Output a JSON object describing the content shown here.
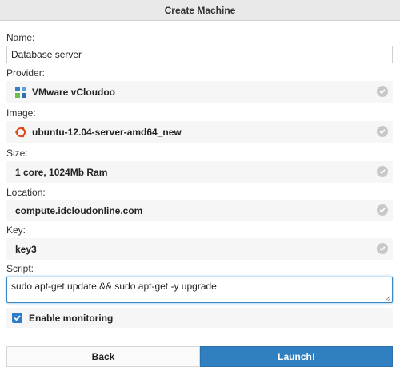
{
  "header": {
    "title": "Create Machine"
  },
  "fields": {
    "name": {
      "label": "Name:",
      "value": "Database server"
    },
    "provider": {
      "label": "Provider:",
      "value": "VMware vCloudoo",
      "icon": "vmware-icon"
    },
    "image": {
      "label": "Image:",
      "value": "ubuntu-12.04-server-amd64_new",
      "icon": "ubuntu-icon"
    },
    "size": {
      "label": "Size:",
      "value": "1 core, 1024Mb Ram"
    },
    "location": {
      "label": "Location:",
      "value": "compute.idcloudonline.com"
    },
    "key": {
      "label": "Key:",
      "value": "key3"
    },
    "script": {
      "label": "Script:",
      "value": "sudo apt-get update && sudo apt-get -y upgrade"
    }
  },
  "monitoring": {
    "label": "Enable monitoring",
    "checked": true
  },
  "buttons": {
    "back": "Back",
    "launch": "Launch!"
  },
  "colors": {
    "accent": "#2f7fc1",
    "header_bg": "#e9e9e9",
    "field_bg": "#f6f6f6",
    "check_gray": "#c8c8c8"
  }
}
